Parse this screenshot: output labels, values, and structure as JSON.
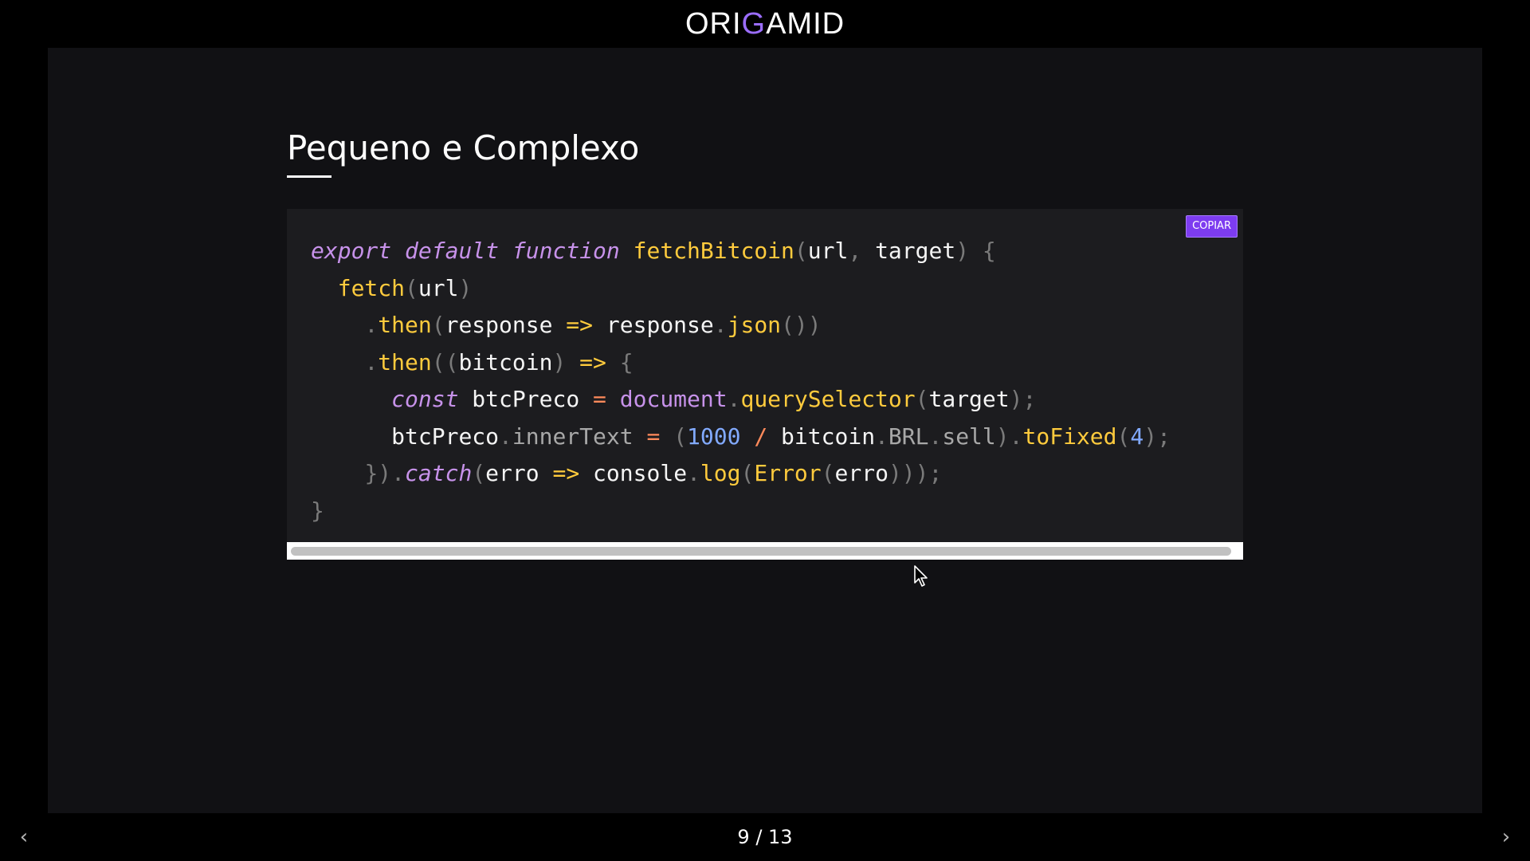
{
  "logo": {
    "text_before": "ORI",
    "text_accent": "G",
    "text_after": "AMID"
  },
  "slide": {
    "title": "Pequeno e Complexo"
  },
  "code_block": {
    "copy_label": "COPIAR",
    "lines": [
      [
        {
          "t": "export",
          "c": "kw"
        },
        {
          "t": " ",
          "c": "id"
        },
        {
          "t": "default",
          "c": "kw"
        },
        {
          "t": " ",
          "c": "id"
        },
        {
          "t": "function",
          "c": "kw"
        },
        {
          "t": " ",
          "c": "id"
        },
        {
          "t": "fetchBitcoin",
          "c": "fn"
        },
        {
          "t": "(",
          "c": "punc"
        },
        {
          "t": "url",
          "c": "id"
        },
        {
          "t": ", ",
          "c": "punc"
        },
        {
          "t": "target",
          "c": "id"
        },
        {
          "t": ") {",
          "c": "punc"
        }
      ],
      [
        {
          "t": "  ",
          "c": "id"
        },
        {
          "t": "fetch",
          "c": "fn"
        },
        {
          "t": "(",
          "c": "punc"
        },
        {
          "t": "url",
          "c": "id"
        },
        {
          "t": ")",
          "c": "punc"
        }
      ],
      [
        {
          "t": "    ",
          "c": "id"
        },
        {
          "t": ".",
          "c": "punc"
        },
        {
          "t": "then",
          "c": "fn"
        },
        {
          "t": "(",
          "c": "punc"
        },
        {
          "t": "response",
          "c": "id"
        },
        {
          "t": " => ",
          "c": "op"
        },
        {
          "t": "response",
          "c": "id"
        },
        {
          "t": ".",
          "c": "punc"
        },
        {
          "t": "json",
          "c": "fn"
        },
        {
          "t": "())",
          "c": "punc"
        }
      ],
      [
        {
          "t": "    ",
          "c": "id"
        },
        {
          "t": ".",
          "c": "punc"
        },
        {
          "t": "then",
          "c": "fn"
        },
        {
          "t": "((",
          "c": "punc"
        },
        {
          "t": "bitcoin",
          "c": "id"
        },
        {
          "t": ")",
          "c": "punc"
        },
        {
          "t": " => ",
          "c": "op"
        },
        {
          "t": "{",
          "c": "punc"
        }
      ],
      [
        {
          "t": "      ",
          "c": "id"
        },
        {
          "t": "const",
          "c": "kw"
        },
        {
          "t": " btcPreco ",
          "c": "id"
        },
        {
          "t": "=",
          "c": "op2"
        },
        {
          "t": " ",
          "c": "id"
        },
        {
          "t": "document",
          "c": "doc"
        },
        {
          "t": ".",
          "c": "punc"
        },
        {
          "t": "querySelector",
          "c": "fn"
        },
        {
          "t": "(",
          "c": "punc"
        },
        {
          "t": "target",
          "c": "id"
        },
        {
          "t": ");",
          "c": "punc"
        }
      ],
      [
        {
          "t": "      ",
          "c": "id"
        },
        {
          "t": "btcPreco",
          "c": "id"
        },
        {
          "t": ".",
          "c": "punc"
        },
        {
          "t": "innerText",
          "c": "prop"
        },
        {
          "t": " ",
          "c": "id"
        },
        {
          "t": "=",
          "c": "op2"
        },
        {
          "t": " (",
          "c": "punc"
        },
        {
          "t": "1000",
          "c": "num"
        },
        {
          "t": " ",
          "c": "id"
        },
        {
          "t": "/",
          "c": "op2"
        },
        {
          "t": " bitcoin",
          "c": "id"
        },
        {
          "t": ".",
          "c": "punc"
        },
        {
          "t": "BRL",
          "c": "prop"
        },
        {
          "t": ".",
          "c": "punc"
        },
        {
          "t": "sell",
          "c": "prop"
        },
        {
          "t": ").",
          "c": "punc"
        },
        {
          "t": "toFixed",
          "c": "fn"
        },
        {
          "t": "(",
          "c": "punc"
        },
        {
          "t": "4",
          "c": "num"
        },
        {
          "t": ");",
          "c": "punc"
        }
      ],
      [
        {
          "t": "    ",
          "c": "id"
        },
        {
          "t": "}).",
          "c": "punc"
        },
        {
          "t": "catch",
          "c": "kw"
        },
        {
          "t": "(",
          "c": "punc"
        },
        {
          "t": "erro",
          "c": "id"
        },
        {
          "t": " => ",
          "c": "op"
        },
        {
          "t": "console",
          "c": "id"
        },
        {
          "t": ".",
          "c": "punc"
        },
        {
          "t": "log",
          "c": "fn"
        },
        {
          "t": "(",
          "c": "punc"
        },
        {
          "t": "Error",
          "c": "fn"
        },
        {
          "t": "(",
          "c": "punc"
        },
        {
          "t": "erro",
          "c": "id"
        },
        {
          "t": ")));",
          "c": "punc"
        }
      ],
      [
        {
          "t": "}",
          "c": "punc"
        }
      ]
    ]
  },
  "pager": {
    "text": "9 / 13",
    "prev_icon": "chevron-left-icon",
    "next_icon": "chevron-right-icon"
  },
  "colors": {
    "accent": "#7d3cf0",
    "slide_bg": "#111114",
    "code_bg": "#1c1c1f"
  }
}
